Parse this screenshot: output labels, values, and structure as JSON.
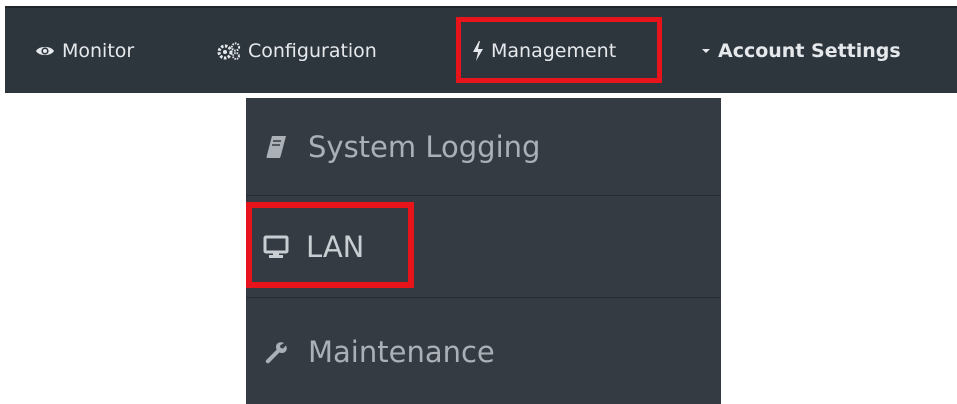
{
  "topnav": {
    "items": [
      {
        "label": "Monitor",
        "icon": "eye-icon"
      },
      {
        "label": "Configuration",
        "icon": "gears-icon"
      },
      {
        "label": "Management",
        "icon": "bolt-icon"
      },
      {
        "label": "Account Settings",
        "icon": "caret-down-icon"
      }
    ]
  },
  "dropdown": {
    "items": [
      {
        "label": "System Logging",
        "icon": "book-icon"
      },
      {
        "label": "LAN",
        "icon": "monitor-icon"
      },
      {
        "label": "Maintenance",
        "icon": "wrench-icon"
      }
    ]
  },
  "colors": {
    "nav_bg": "#2d353d",
    "dropdown_bg": "#343b43",
    "highlight": "#e8141c",
    "nav_text": "#e6e9ec",
    "menu_text": "#aab0b6"
  }
}
